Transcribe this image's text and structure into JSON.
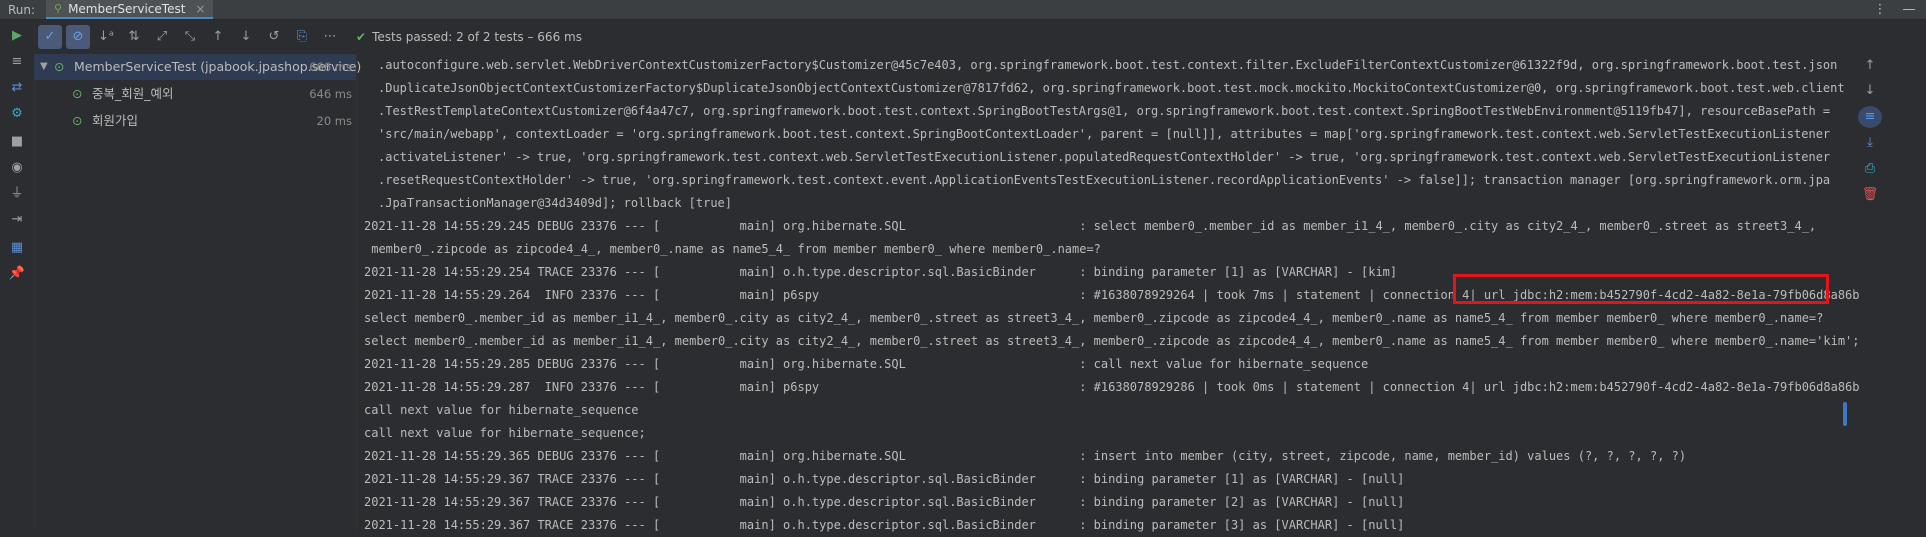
{
  "topbar": {
    "run_label": "Run:",
    "tab_label": "MemberServiceTest",
    "close_glyph": "×",
    "menu_glyph": "⋮",
    "minimize_glyph": "—"
  },
  "toolbar": {
    "status_text": "Tests passed: 2 of 2 tests – 666 ms"
  },
  "tree": {
    "root": {
      "label": "MemberServiceTest (jpabook.jpashop.service)",
      "time": "666 ms"
    },
    "items": [
      {
        "label": "중복_회원_예외",
        "time": "646 ms"
      },
      {
        "label": "회원가입",
        "time": "20 ms"
      }
    ]
  },
  "console": {
    "lines": [
      ".autoconfigure.web.servlet.WebDriverContextCustomizerFactory$Customizer@45c7e403, org.springframework.boot.test.context.filter.ExcludeFilterContextCustomizer@61322f9d, org.springframework.boot.test.json",
      ".DuplicateJsonObjectContextCustomizerFactory$DuplicateJsonObjectContextCustomizer@7817fd62, org.springframework.boot.test.mock.mockito.MockitoContextCustomizer@0, org.springframework.boot.test.web.client",
      ".TestRestTemplateContextCustomizer@6f4a47c7, org.springframework.boot.test.context.SpringBootTestArgs@1, org.springframework.boot.test.context.SpringBootTestWebEnvironment@5119fb47], resourceBasePath =",
      "'src/main/webapp', contextLoader = 'org.springframework.boot.test.context.SpringBootContextLoader', parent = [null]], attributes = map['org.springframework.test.context.web.ServletTestExecutionListener",
      ".activateListener' -> true, 'org.springframework.test.context.web.ServletTestExecutionListener.populatedRequestContextHolder' -> true, 'org.springframework.test.context.web.ServletTestExecutionListener",
      ".resetRequestContextHolder' -> true, 'org.springframework.test.context.event.ApplicationEventsTestExecutionListener.recordApplicationEvents' -> false]]; transaction manager [org.springframework.orm.jpa",
      ".JpaTransactionManager@34d3409d]; rollback [true]",
      "2021-11-28 14:55:29.245 DEBUG 23376 --- [           main] org.hibernate.SQL                        : select member0_.member_id as member_i1_4_, member0_.city as city2_4_, member0_.street as street3_4_,",
      " member0_.zipcode as zipcode4_4_, member0_.name as name5_4_ from member member0_ where member0_.name=?",
      "2021-11-28 14:55:29.254 TRACE 23376 --- [           main] o.h.type.descriptor.sql.BasicBinder      : binding parameter [1] as [VARCHAR] - [kim]",
      "2021-11-28 14:55:29.264  INFO 23376 --- [           main] p6spy                                    : #1638078929264 | took 7ms | statement | connection 4| url jdbc:h2:mem:b452790f-4cd2-4a82-8e1a-79fb06d8a86b",
      "select member0_.member_id as member_i1_4_, member0_.city as city2_4_, member0_.street as street3_4_, member0_.zipcode as zipcode4_4_, member0_.name as name5_4_ from member member0_ where member0_.name=?",
      "select member0_.member_id as member_i1_4_, member0_.city as city2_4_, member0_.street as street3_4_, member0_.zipcode as zipcode4_4_, member0_.name as name5_4_ from member member0_ where member0_.name='kim';",
      "2021-11-28 14:55:29.285 DEBUG 23376 --- [           main] org.hibernate.SQL                        : call next value for hibernate_sequence",
      "2021-11-28 14:55:29.287  INFO 23376 --- [           main] p6spy                                    : #1638078929286 | took 0ms | statement | connection 4| url jdbc:h2:mem:b452790f-4cd2-4a82-8e1a-79fb06d8a86b",
      "call next value for hibernate_sequence",
      "call next value for hibernate_sequence;",
      "2021-11-28 14:55:29.365 DEBUG 23376 --- [           main] org.hibernate.SQL                        : insert into member (city, street, zipcode, name, member_id) values (?, ?, ?, ?, ?)",
      "2021-11-28 14:55:29.367 TRACE 23376 --- [           main] o.h.type.descriptor.sql.BasicBinder      : binding parameter [1] as [VARCHAR] - [null]",
      "2021-11-28 14:55:29.367 TRACE 23376 --- [           main] o.h.type.descriptor.sql.BasicBinder      : binding parameter [2] as [VARCHAR] - [null]",
      "2021-11-28 14:55:29.367 TRACE 23376 --- [           main] o.h.type.descriptor.sql.BasicBinder      : binding parameter [3] as [VARCHAR] - [null]"
    ]
  },
  "icons": {
    "run": "play-icon",
    "pass": "check-circle-icon"
  },
  "colors": {
    "background": "#2b2d30",
    "pass_green": "#5fb35f",
    "highlight_red": "#e3141b",
    "accent_blue": "#4a88c7"
  }
}
